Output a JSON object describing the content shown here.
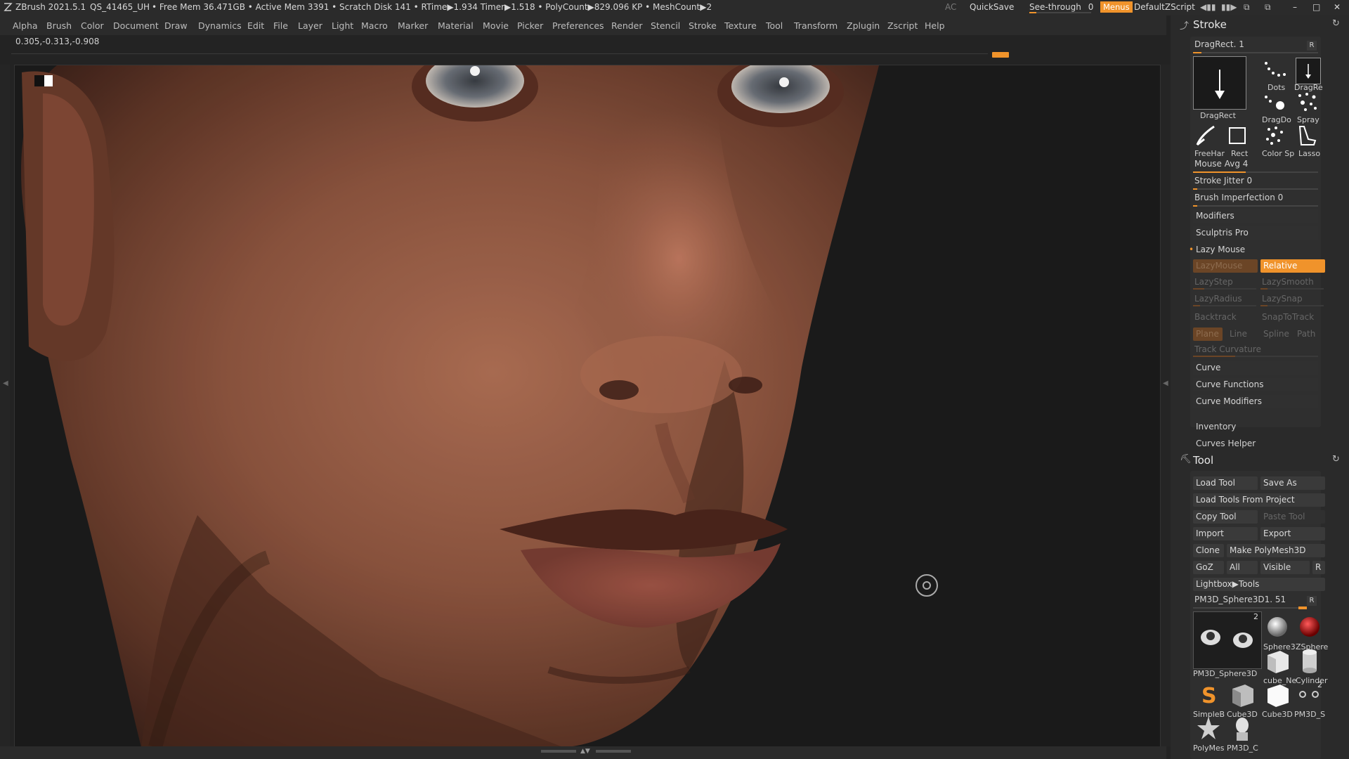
{
  "titlebar": {
    "app": "ZBrush 2021.5.1",
    "doc": "QS_41465_UH",
    "stats": "• Free Mem 36.471GB • Active Mem 3391 • Scratch Disk 141 •  RTime▶1.934 Timer▶1.518 • PolyCount▶829.096 KP • MeshCount▶2",
    "ac": "AC",
    "quicksave": "QuickSave",
    "seethrough": "See-through",
    "seethrough_value": "0",
    "menus": "Menus",
    "script": "DefaultZScript"
  },
  "menubar": [
    "Alpha",
    "Brush",
    "Color",
    "Document",
    "Draw",
    "Dynamics",
    "Edit",
    "File",
    "Layer",
    "Light",
    "Macro",
    "Marker",
    "Material",
    "Movie",
    "Picker",
    "Preferences",
    "Render",
    "Stencil",
    "Stroke",
    "Texture",
    "Tool",
    "Transform",
    "Zplugin",
    "Zscript",
    "Help"
  ],
  "coord": "0.305,-0.313,-0.908",
  "stroke": {
    "title": "Stroke",
    "current": "DragRect. 1",
    "r": "R",
    "types": [
      {
        "label": "DragRect",
        "icon": "dragrect-large-icon"
      },
      {
        "label": "Dots",
        "icon": "dots-icon"
      },
      {
        "label": "DragRe",
        "icon": "dragrect-small-icon"
      },
      {
        "label": "DragDo",
        "icon": "dragdot-icon"
      },
      {
        "label": "Spray",
        "icon": "spray-icon"
      },
      {
        "label": "FreeHar",
        "icon": "freehand-icon"
      },
      {
        "label": "Rect",
        "icon": "rect-icon"
      },
      {
        "label": "Color Sp",
        "icon": "colorspray-icon"
      },
      {
        "label": "Lasso",
        "icon": "lasso-icon"
      }
    ],
    "mouse_avg": "Mouse Avg 4",
    "stroke_jitter": "Stroke Jitter 0",
    "brush_imperfection": "Brush Imperfection 0",
    "modifiers": "Modifiers",
    "sculptris_pro": "Sculptris Pro",
    "lazy_mouse": "Lazy Mouse",
    "lazymouse_btn": "LazyMouse",
    "relative_btn": "Relative",
    "lazystep": "LazyStep",
    "lazysmooth": "LazySmooth",
    "lazyradius": "LazyRadius",
    "lazysnap": "LazySnap",
    "backtrack": "Backtrack",
    "snaptotrack": "SnapToTrack",
    "plane": "Plane",
    "line": "Line",
    "spline": "Spline",
    "path": "Path",
    "track_curvature": "Track Curvature",
    "curve": "Curve",
    "curve_functions": "Curve Functions",
    "curve_modifiers": "Curve Modifiers",
    "inventory": "Inventory",
    "curves_helper": "Curves Helper",
    "mouse_avg_level": 0.42,
    "stroke_jitter_level": 0.0,
    "brush_imperfection_level": 0.0
  },
  "tool": {
    "title": "Tool",
    "load_tool": "Load Tool",
    "save_as": "Save As",
    "load_from_project": "Load Tools From Project",
    "copy_tool": "Copy Tool",
    "paste_tool": "Paste Tool",
    "import": "Import",
    "export": "Export",
    "clone": "Clone",
    "make_polymesh": "Make PolyMesh3D",
    "goz": "GoZ",
    "all": "All",
    "visible": "Visible",
    "r": "R",
    "lightbox_tools": "Lightbox▶Tools",
    "current_tool": "PM3D_Sphere3D1. 51",
    "current_count": "2",
    "thumbs": [
      "PM3D_Sphere3D",
      "Sphere3",
      "ZSphere",
      "cube_Ne",
      "Cylinder",
      "SimpleB",
      "Cube3D",
      "Cube3D",
      "PM3D_S",
      "PolyMes",
      "PM3D_C"
    ],
    "pm3d_s_count": "2"
  }
}
